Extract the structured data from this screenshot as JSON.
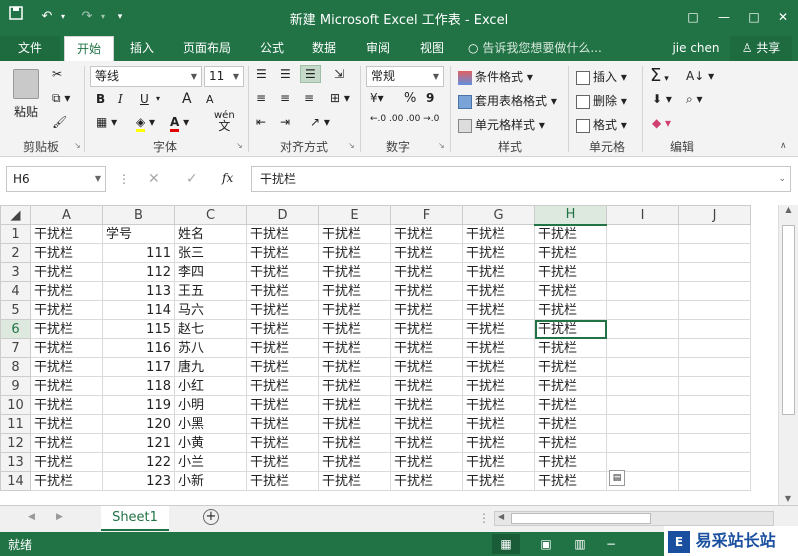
{
  "titlebar": {
    "title": "新建 Microsoft Excel 工作表 - Excel",
    "save_icon": "save-icon",
    "undo_icon": "undo-icon",
    "redo_icon": "redo-icon",
    "customize_icon": "customize-icon",
    "restore_label": "□",
    "minimize_label": "—",
    "maximize_label": "□",
    "close_label": "✕"
  },
  "tabs": {
    "file": "文件",
    "home": "开始",
    "insert": "插入",
    "page_layout": "页面布局",
    "formulas": "公式",
    "data": "数据",
    "review": "审阅",
    "view": "视图",
    "tell_me": "告诉我您想要做什么...",
    "user": "jie chen",
    "share": "共享"
  },
  "ribbon": {
    "clipboard": {
      "paste": "粘贴",
      "label": "剪贴板"
    },
    "font": {
      "name": "等线",
      "size": "11",
      "bold": "B",
      "italic": "I",
      "underline": "U",
      "grow": "A",
      "shrink": "A",
      "wen": "wén",
      "label": "字体"
    },
    "alignment": {
      "label": "对齐方式"
    },
    "number": {
      "format": "常规",
      "percent": "%",
      "comma": "9",
      "inc_decimal": "←.0 .00",
      "dec_decimal": ".00 →.0",
      "label": "数字"
    },
    "styles": {
      "conditional": "条件格式",
      "table": "套用表格格式",
      "cell": "单元格样式",
      "label": "样式"
    },
    "cells": {
      "insert": "插入",
      "delete": "删除",
      "format": "格式",
      "label": "单元格"
    },
    "editing": {
      "sum": "Σ",
      "label": "编辑"
    }
  },
  "formula_bar": {
    "name_box": "H6",
    "fx": "fx",
    "value": "干扰栏"
  },
  "sheet": {
    "columns": [
      "A",
      "B",
      "C",
      "D",
      "E",
      "F",
      "G",
      "H",
      "I",
      "J"
    ],
    "selected_col": "H",
    "selected_row": 6,
    "rows": [
      [
        "干扰栏",
        "学号",
        "姓名",
        "干扰栏",
        "干扰栏",
        "干扰栏",
        "干扰栏",
        "干扰栏",
        "",
        ""
      ],
      [
        "干扰栏",
        "111",
        "张三",
        "干扰栏",
        "干扰栏",
        "干扰栏",
        "干扰栏",
        "干扰栏",
        "",
        ""
      ],
      [
        "干扰栏",
        "112",
        "李四",
        "干扰栏",
        "干扰栏",
        "干扰栏",
        "干扰栏",
        "干扰栏",
        "",
        ""
      ],
      [
        "干扰栏",
        "113",
        "王五",
        "干扰栏",
        "干扰栏",
        "干扰栏",
        "干扰栏",
        "干扰栏",
        "",
        ""
      ],
      [
        "干扰栏",
        "114",
        "马六",
        "干扰栏",
        "干扰栏",
        "干扰栏",
        "干扰栏",
        "干扰栏",
        "",
        ""
      ],
      [
        "干扰栏",
        "115",
        "赵七",
        "干扰栏",
        "干扰栏",
        "干扰栏",
        "干扰栏",
        "干扰栏",
        "",
        ""
      ],
      [
        "干扰栏",
        "116",
        "苏八",
        "干扰栏",
        "干扰栏",
        "干扰栏",
        "干扰栏",
        "干扰栏",
        "",
        ""
      ],
      [
        "干扰栏",
        "117",
        "唐九",
        "干扰栏",
        "干扰栏",
        "干扰栏",
        "干扰栏",
        "干扰栏",
        "",
        ""
      ],
      [
        "干扰栏",
        "118",
        "小红",
        "干扰栏",
        "干扰栏",
        "干扰栏",
        "干扰栏",
        "干扰栏",
        "",
        ""
      ],
      [
        "干扰栏",
        "119",
        "小明",
        "干扰栏",
        "干扰栏",
        "干扰栏",
        "干扰栏",
        "干扰栏",
        "",
        ""
      ],
      [
        "干扰栏",
        "120",
        "小黑",
        "干扰栏",
        "干扰栏",
        "干扰栏",
        "干扰栏",
        "干扰栏",
        "",
        ""
      ],
      [
        "干扰栏",
        "121",
        "小黄",
        "干扰栏",
        "干扰栏",
        "干扰栏",
        "干扰栏",
        "干扰栏",
        "",
        ""
      ],
      [
        "干扰栏",
        "122",
        "小兰",
        "干扰栏",
        "干扰栏",
        "干扰栏",
        "干扰栏",
        "干扰栏",
        "",
        ""
      ],
      [
        "干扰栏",
        "123",
        "小新",
        "干扰栏",
        "干扰栏",
        "干扰栏",
        "干扰栏",
        "干扰栏",
        "",
        ""
      ]
    ]
  },
  "sheet_tabs": {
    "active": "Sheet1",
    "add": "+"
  },
  "status": {
    "ready": "就绪",
    "watermark": "易采站长站"
  },
  "colors": {
    "accent": "#217346"
  }
}
